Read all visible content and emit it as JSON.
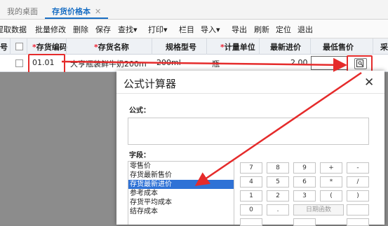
{
  "tabs": {
    "home": "我的桌面",
    "active": "存货价格本",
    "close": "✕"
  },
  "toolbar": [
    "提取数据",
    "批量修改",
    "删除",
    "保存",
    "查找▾",
    "打印▾",
    "栏目",
    "导入▾",
    "导出",
    "刷新",
    "定位",
    "退出"
  ],
  "grid": {
    "headers": {
      "no": "号",
      "code": "存货编码",
      "name": "存货名称",
      "spec": "规格型号",
      "unit": "计量单位",
      "latest": "最新进价",
      "min": "最低售价",
      "extra": "采"
    },
    "row": {
      "code": "01.01",
      "name": "大亨瓶装鲜牛奶200m",
      "spec": "200ml",
      "unit": "瓶",
      "latest": "2.00"
    }
  },
  "dialog": {
    "title": "公式计算器",
    "close": "✕",
    "formula_label": "公式：",
    "field_label": "字段：",
    "fields": [
      "零售价",
      "存货最新售价",
      "存货最新进价",
      "参考成本",
      "存货平均成本",
      "结存成本"
    ],
    "selected": "存货最新进价",
    "keys": [
      [
        "7",
        "8",
        "9",
        "+",
        "-"
      ],
      [
        "4",
        "5",
        "6",
        "*",
        "/"
      ],
      [
        "1",
        "2",
        "3",
        "(",
        ")"
      ],
      [
        "0",
        ".",
        "日期函数",
        ""
      ]
    ]
  },
  "colors": {
    "accent": "#1a6fc4",
    "highlight": "#e52b2b",
    "selection": "#2f72d6"
  }
}
